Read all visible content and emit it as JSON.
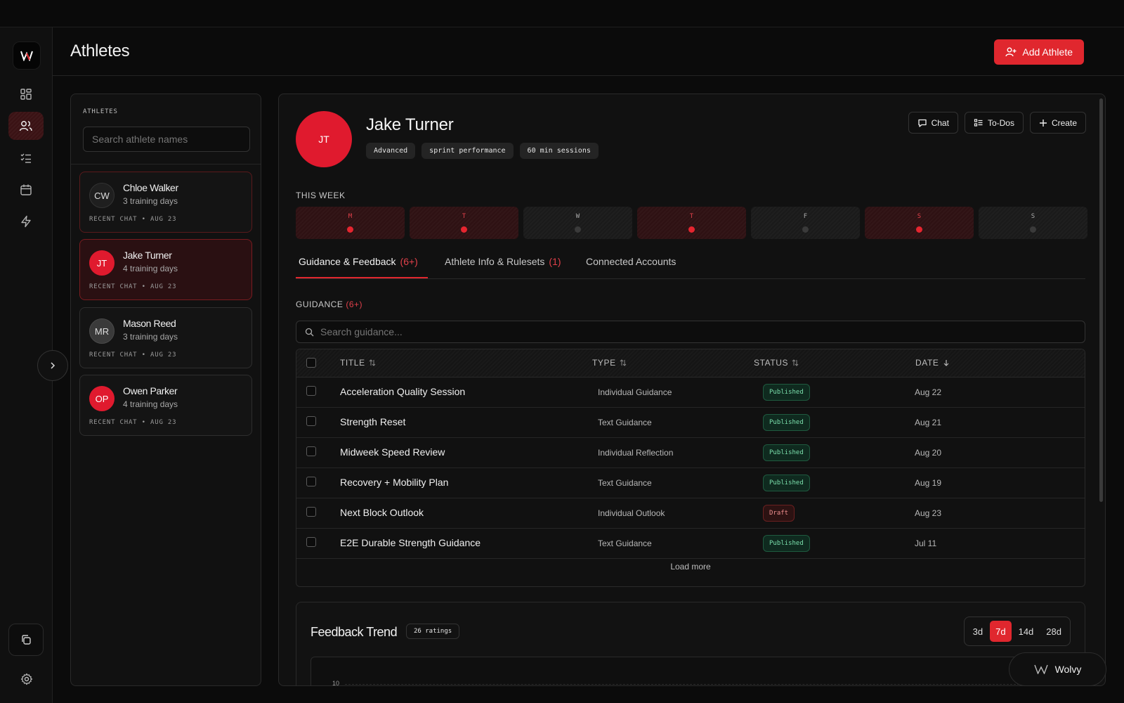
{
  "app": {
    "page_title": "Athletes",
    "add_button": "Add Athlete",
    "brand_name": "Wolvy"
  },
  "rail": {
    "items": [
      {
        "icon": "dashboard-icon"
      },
      {
        "icon": "users-icon",
        "active": true
      },
      {
        "icon": "checklist-icon"
      },
      {
        "icon": "calendar-icon"
      },
      {
        "icon": "lightning-icon"
      }
    ],
    "bottom_icon": "copy-icon",
    "settings_icon": "gear-icon"
  },
  "athletes_panel": {
    "caption": "ATHLETES",
    "search_placeholder": "Search athlete names",
    "list": [
      {
        "initials": "CW",
        "name": "Chloe Walker",
        "sub": "3 training days",
        "meta": "RECENT CHAT • AUG 23"
      },
      {
        "initials": "JT",
        "name": "Jake Turner",
        "sub": "4 training days",
        "meta": "RECENT CHAT • AUG 23"
      },
      {
        "initials": "MR",
        "name": "Mason Reed",
        "sub": "3 training days",
        "meta": "RECENT CHAT • AUG 23"
      },
      {
        "initials": "OP",
        "name": "Owen Parker",
        "sub": "4 training days",
        "meta": "RECENT CHAT • AUG 23"
      }
    ]
  },
  "profile": {
    "initials": "JT",
    "name": "Jake Turner",
    "tags": [
      "Advanced",
      "sprint performance",
      "60 min sessions"
    ],
    "actions": {
      "chat": "Chat",
      "todos": "To-Dos",
      "create": "Create"
    }
  },
  "week": {
    "caption": "THIS WEEK",
    "days": [
      {
        "label": "M",
        "active": true
      },
      {
        "label": "T",
        "active": true
      },
      {
        "label": "W",
        "active": false
      },
      {
        "label": "T",
        "active": true
      },
      {
        "label": "F",
        "active": false
      },
      {
        "label": "S",
        "active": true
      },
      {
        "label": "S",
        "active": false
      }
    ]
  },
  "tabs": [
    {
      "label": "Guidance & Feedback",
      "count": "(6+)"
    },
    {
      "label": "Athlete Info & Rulesets",
      "count": "(1)"
    },
    {
      "label": "Connected Accounts",
      "count": ""
    }
  ],
  "guidance": {
    "caption": "GUIDANCE",
    "count": "(6+)",
    "search_placeholder": "Search guidance...",
    "columns": {
      "title": "TITLE",
      "type": "TYPE",
      "status": "STATUS",
      "date": "DATE"
    },
    "rows": [
      {
        "title": "Acceleration Quality Session",
        "type": "Individual Guidance",
        "status": "Published",
        "date": "Aug 22"
      },
      {
        "title": "Strength Reset",
        "type": "Text Guidance",
        "status": "Published",
        "date": "Aug 21"
      },
      {
        "title": "Midweek Speed Review",
        "type": "Individual Reflection",
        "status": "Published",
        "date": "Aug 20"
      },
      {
        "title": "Recovery + Mobility Plan",
        "type": "Text Guidance",
        "status": "Published",
        "date": "Aug 19"
      },
      {
        "title": "Next Block Outlook",
        "type": "Individual Outlook",
        "status": "Draft",
        "date": "Aug 23"
      },
      {
        "title": "E2E Durable Strength Guidance",
        "type": "Text Guidance",
        "status": "Published",
        "date": "Jul 11"
      }
    ],
    "load_more": "Load more"
  },
  "feedback": {
    "title": "Feedback Trend",
    "ratings": "26 ratings",
    "ranges": [
      "3d",
      "7d",
      "14d",
      "28d"
    ],
    "selected_range": "7d",
    "y_tick": "10"
  },
  "colors": {
    "accent": "#e0272e",
    "published": "#7be0ad",
    "draft": "#f09090"
  }
}
